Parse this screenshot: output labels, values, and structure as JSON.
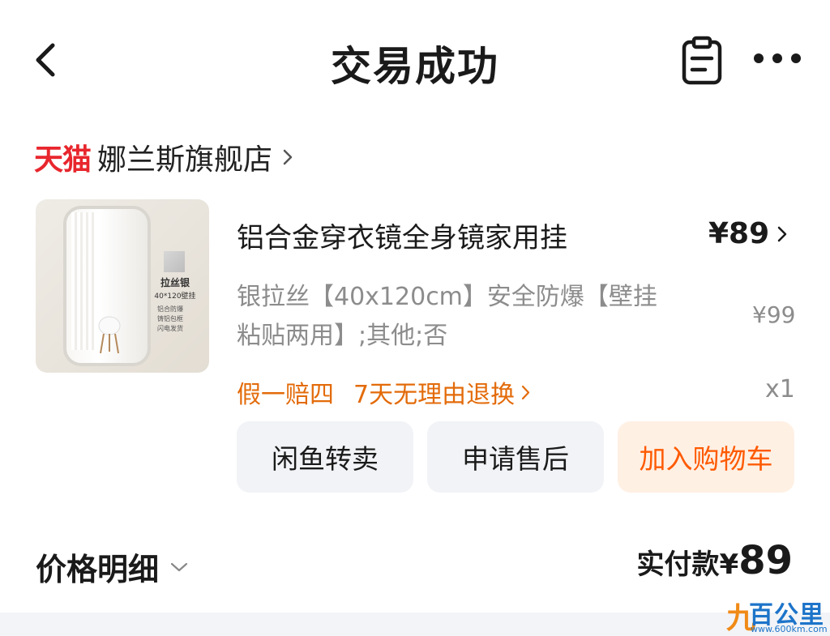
{
  "header": {
    "title": "交易成功"
  },
  "store": {
    "brand": "天猫",
    "name": "娜兰斯旗舰店"
  },
  "product": {
    "title": "铝合金穿衣镜全身镜家用挂",
    "price": "¥89",
    "original_price": "¥99",
    "spec": "银拉丝【40x120cm】安全防爆【壁挂粘贴两用】;其他;否",
    "quantity": "x1",
    "guarantee_1": "假一赔四",
    "guarantee_2": "7天无理由退换",
    "image_text": {
      "title": "拉丝银",
      "size": "40*120壁挂",
      "features": [
        "铝合防爆",
        "铸铝包框",
        "闪电发货"
      ]
    }
  },
  "actions": {
    "resell": "闲鱼转卖",
    "after_sale": "申请售后",
    "add_to_cart": "加入购物车"
  },
  "price_detail": {
    "label": "价格明细",
    "paid_label": "实付款¥",
    "paid_amount": "89"
  },
  "watermark": {
    "digit": "九",
    "name": "百公里",
    "url": "www.600km.com"
  },
  "colors": {
    "tmall_red": "#e8262d",
    "guarantee_orange": "#e36b0a",
    "cart_orange": "#ff5a00",
    "cart_bg": "#fff0e4",
    "button_bg": "#f1f3f6"
  }
}
